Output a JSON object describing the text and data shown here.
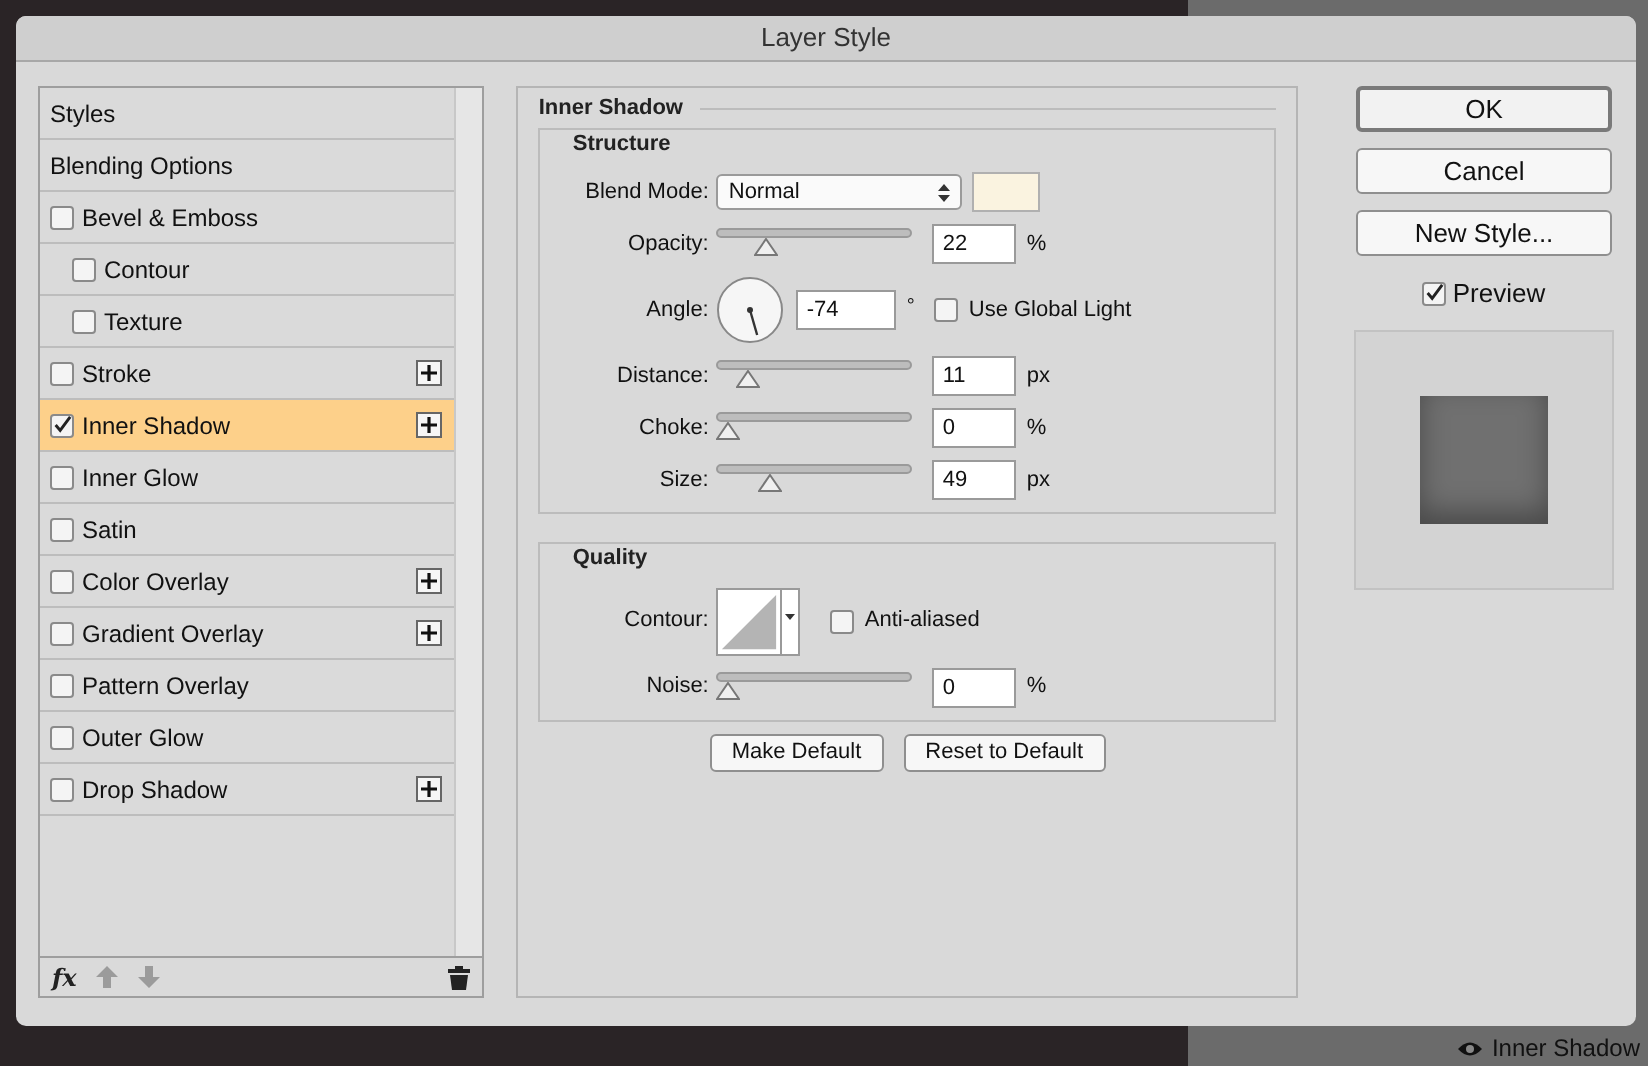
{
  "window": {
    "title": "Layer Style"
  },
  "styles_list": {
    "items": [
      {
        "kind": "header",
        "label": "Styles",
        "selected": false
      },
      {
        "kind": "header",
        "label": "Blending Options",
        "selected": false
      },
      {
        "kind": "effect",
        "label": "Bevel & Emboss",
        "checked": false,
        "selected": false,
        "add_button": false,
        "children": [
          {
            "kind": "effect",
            "label": "Contour",
            "checked": false,
            "selected": false,
            "add_button": false
          },
          {
            "kind": "effect",
            "label": "Texture",
            "checked": false,
            "selected": false,
            "add_button": false
          }
        ]
      },
      {
        "kind": "effect",
        "label": "Stroke",
        "checked": false,
        "selected": false,
        "add_button": true
      },
      {
        "kind": "effect",
        "label": "Inner Shadow",
        "checked": true,
        "selected": true,
        "add_button": true
      },
      {
        "kind": "effect",
        "label": "Inner Glow",
        "checked": false,
        "selected": false,
        "add_button": false
      },
      {
        "kind": "effect",
        "label": "Satin",
        "checked": false,
        "selected": false,
        "add_button": false
      },
      {
        "kind": "effect",
        "label": "Color Overlay",
        "checked": false,
        "selected": false,
        "add_button": true
      },
      {
        "kind": "effect",
        "label": "Gradient Overlay",
        "checked": false,
        "selected": false,
        "add_button": true
      },
      {
        "kind": "effect",
        "label": "Pattern Overlay",
        "checked": false,
        "selected": false,
        "add_button": false
      },
      {
        "kind": "effect",
        "label": "Outer Glow",
        "checked": false,
        "selected": false,
        "add_button": false
      },
      {
        "kind": "effect",
        "label": "Drop Shadow",
        "checked": false,
        "selected": false,
        "add_button": true
      }
    ],
    "toolbar": {
      "fx_label": "fx"
    }
  },
  "panel": {
    "title": "Inner Shadow",
    "sections": [
      {
        "title": "Structure",
        "rows": [
          {
            "kind": "select",
            "label": "Blend Mode:",
            "value": "Normal"
          },
          {
            "kind": "slider",
            "label": "Opacity:",
            "level": 0.22,
            "value": "22",
            "unit": "%"
          },
          {
            "kind": "angle",
            "label": "Angle:",
            "value": "-74",
            "unit": "°",
            "checkbox": {
              "label": "Use Global Light",
              "checked": false
            }
          },
          {
            "kind": "slider",
            "label": "Distance:",
            "level": 0.11,
            "value": "11",
            "unit": "px"
          },
          {
            "kind": "slider",
            "label": "Choke:",
            "level": 0,
            "value": "0",
            "unit": "%"
          },
          {
            "kind": "slider",
            "label": "Size:",
            "level": 0.24,
            "value": "49",
            "unit": "px"
          }
        ]
      },
      {
        "title": "Quality",
        "rows": [
          {
            "kind": "contour",
            "label": "Contour:",
            "checkbox": {
              "label": "Anti-aliased",
              "checked": false
            }
          },
          {
            "kind": "slider",
            "label": "Noise:",
            "level": 0,
            "value": "0",
            "unit": "%"
          }
        ]
      }
    ],
    "buttons": [
      "Make Default",
      "Reset to Default"
    ]
  },
  "actions": {
    "buttons": [
      {
        "label": "OK",
        "default": true
      },
      {
        "label": "Cancel",
        "default": false
      },
      {
        "label": "New Style...",
        "default": false
      }
    ],
    "preview": {
      "label": "Preview",
      "checked": true
    }
  },
  "background": {
    "layer_label": "Inner Shadow"
  }
}
